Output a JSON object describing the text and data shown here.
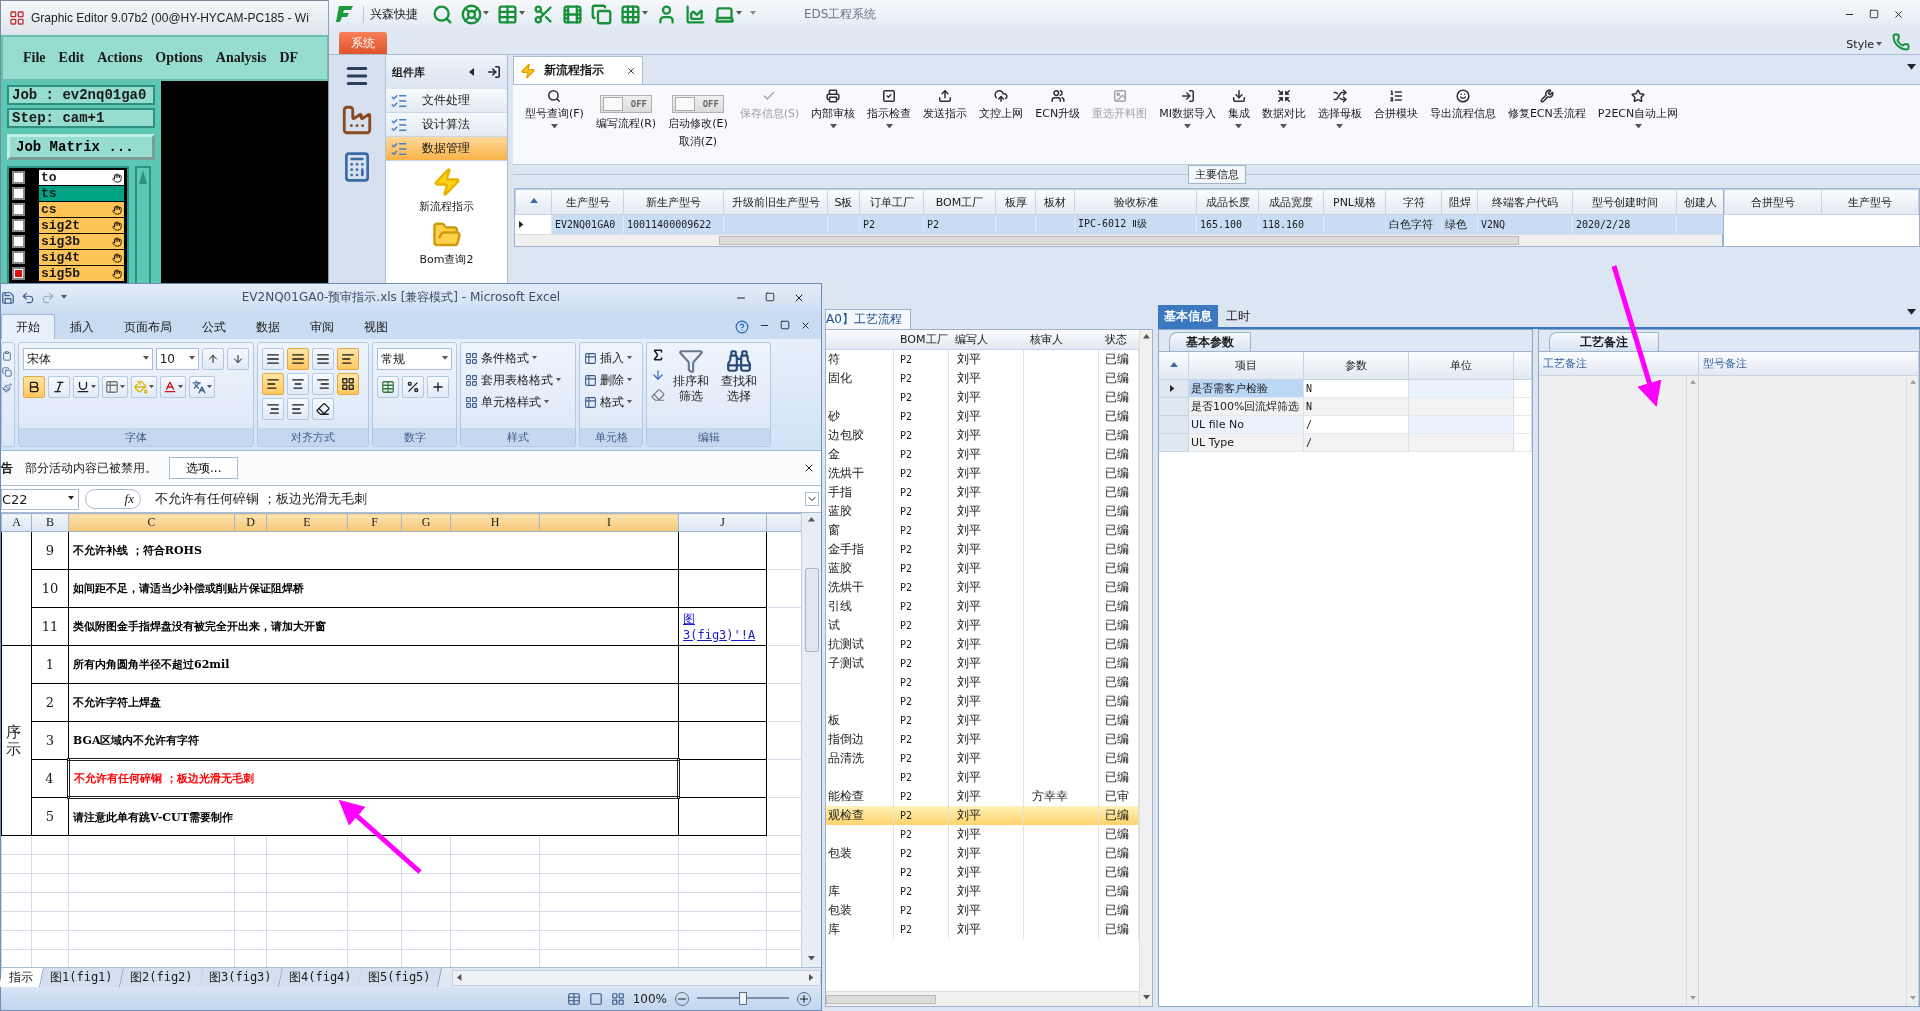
{
  "graphic_editor": {
    "title": "Graphic Editor 9.07b2 (00@HY-HYCAM-PC185 - Wi",
    "menu": [
      "File",
      "Edit",
      "Actions",
      "Options",
      "Analysis",
      "DF"
    ],
    "job": "Job : ev2nq01ga0",
    "step": "Step: cam+1",
    "matrix_button": "Job Matrix ...",
    "layers": [
      {
        "name": "to",
        "color": "#ffffff",
        "checked": false,
        "pointer": true
      },
      {
        "name": "ts",
        "color": "#00a383",
        "checked": false,
        "pointer": false
      },
      {
        "name": "cs",
        "color": "#ffc457",
        "checked": false,
        "pointer": true
      },
      {
        "name": "sig2t",
        "color": "#ffc457",
        "checked": false,
        "pointer": true
      },
      {
        "name": "sig3b",
        "color": "#ffc457",
        "checked": false,
        "pointer": true
      },
      {
        "name": "sig4t",
        "color": "#ffc457",
        "checked": false,
        "pointer": true
      },
      {
        "name": "sig5b",
        "color": "#ffc457",
        "checked": true,
        "pointer": true
      }
    ]
  },
  "eds": {
    "quick_label": "兴森快捷",
    "title": "EDS工程系统",
    "system_tab": "系统",
    "style_menu": "Style",
    "components": {
      "title": "组件库",
      "items": [
        {
          "label": "文件处理",
          "selected": false
        },
        {
          "label": "设计算法",
          "selected": false
        },
        {
          "label": "数据管理",
          "selected": true
        }
      ],
      "launchers": [
        "新流程指示",
        "Bom查询2"
      ]
    },
    "doc_tab": "新流程指示",
    "toolbar": [
      {
        "kind": "button",
        "label": "型号查询(F)",
        "dropdown": true,
        "disabled": false
      },
      {
        "kind": "toggle",
        "label": "编写流程(R)",
        "state_text": "OFF",
        "on": false
      },
      {
        "kind": "toggle",
        "label": "启动修改(E)",
        "sublabel": "取消(Z)",
        "state_text": "OFF",
        "on": false
      },
      {
        "kind": "button",
        "label": "保存信息(S)",
        "dropdown": false,
        "disabled": true
      },
      {
        "kind": "button",
        "label": "内部审核",
        "dropdown": true,
        "disabled": false
      },
      {
        "kind": "button",
        "label": "指示检查",
        "dropdown": true,
        "disabled": false
      },
      {
        "kind": "button",
        "label": "发送指示",
        "dropdown": false,
        "disabled": false
      },
      {
        "kind": "button",
        "label": "文控上网",
        "dropdown": false,
        "disabled": false
      },
      {
        "kind": "button",
        "label": "ECN升级",
        "dropdown": false,
        "disabled": false
      },
      {
        "kind": "button",
        "label": "重选开料图",
        "dropdown": false,
        "disabled": true
      },
      {
        "kind": "button",
        "label": "MI数据导入",
        "dropdown": true,
        "disabled": false
      },
      {
        "kind": "button",
        "label": "集成",
        "dropdown": true,
        "disabled": false
      },
      {
        "kind": "button",
        "label": "数据对比",
        "dropdown": true,
        "disabled": false
      },
      {
        "kind": "button",
        "label": "选择母板",
        "dropdown": true,
        "disabled": false
      },
      {
        "kind": "button",
        "label": "合拼模块",
        "dropdown": false,
        "disabled": false
      },
      {
        "kind": "button",
        "label": "导出流程信息",
        "dropdown": false,
        "disabled": false
      },
      {
        "kind": "button",
        "label": "修复ECN丢流程",
        "dropdown": false,
        "disabled": false
      },
      {
        "kind": "button",
        "label": "P2ECN自动上网",
        "dropdown": true,
        "disabled": false
      }
    ],
    "main_info": {
      "legend": "主要信息",
      "row_selected": true,
      "columns": [
        {
          "label": "生产型号",
          "value": "EV2NQ01GA0"
        },
        {
          "label": "新生产型号",
          "value": "10011400009622"
        },
        {
          "label": "升级前旧生产型号"
        },
        {
          "label": "S板"
        },
        {
          "label": "订单工厂",
          "value": "P2"
        },
        {
          "label": "BOM工厂",
          "value": "P2"
        },
        {
          "label": "板厚"
        },
        {
          "label": "板材"
        },
        {
          "label": "验收标准",
          "value": "IPC-6012 Ⅱ级"
        },
        {
          "label": "成品长度",
          "value": "165.100"
        },
        {
          "label": "成品宽度",
          "value": "118.160"
        },
        {
          "label": "PNL规格"
        },
        {
          "label": "字符",
          "value": "白色字符"
        },
        {
          "label": "阻焊",
          "value": "绿色"
        },
        {
          "label": "终端客户代码",
          "value": "V2NQ"
        },
        {
          "label": "型号创建时间",
          "value": "2020/2/28"
        },
        {
          "label": "创建人"
        }
      ],
      "side_columns": [
        "合拼型号",
        "生产型号"
      ]
    },
    "process": {
      "tab": "A0】工艺流程",
      "columns": [
        "BOM工厂",
        "编写人",
        "核审人",
        "状态"
      ],
      "rows": [
        {
          "step": "符",
          "factory": "P2",
          "author": "刘平",
          "status": "已编",
          "selected": false
        },
        {
          "step": "固化",
          "factory": "P2",
          "author": "刘平",
          "status": "已编",
          "selected": false
        },
        {
          "factory": "P2",
          "author": "刘平",
          "status": "已编",
          "selected": false
        },
        {
          "step": "砂",
          "factory": "P2",
          "author": "刘平",
          "status": "已编",
          "selected": false
        },
        {
          "step": "边包胶",
          "factory": "P2",
          "author": "刘平",
          "status": "已编",
          "selected": false
        },
        {
          "step": "金",
          "factory": "P2",
          "author": "刘平",
          "status": "已编",
          "selected": false
        },
        {
          "step": "洗烘干",
          "factory": "P2",
          "author": "刘平",
          "status": "已编",
          "selected": false
        },
        {
          "step": "手指",
          "factory": "P2",
          "author": "刘平",
          "status": "已编",
          "selected": false
        },
        {
          "step": "蓝胶",
          "factory": "P2",
          "author": "刘平",
          "status": "已编",
          "selected": false
        },
        {
          "step": "窗",
          "factory": "P2",
          "author": "刘平",
          "status": "已编",
          "selected": false
        },
        {
          "step": "金手指",
          "factory": "P2",
          "author": "刘平",
          "status": "已编",
          "selected": false
        },
        {
          "step": "蓝胶",
          "factory": "P2",
          "author": "刘平",
          "status": "已编",
          "selected": false
        },
        {
          "step": "洗烘干",
          "factory": "P2",
          "author": "刘平",
          "status": "已编",
          "selected": false
        },
        {
          "step": "引线",
          "factory": "P2",
          "author": "刘平",
          "status": "已编",
          "selected": false
        },
        {
          "step": "试",
          "factory": "P2",
          "author": "刘平",
          "status": "已编",
          "selected": false
        },
        {
          "step": "抗测试",
          "factory": "P2",
          "author": "刘平",
          "status": "已编",
          "selected": false
        },
        {
          "step": "子测试",
          "factory": "P2",
          "author": "刘平",
          "status": "已编",
          "selected": false
        },
        {
          "factory": "P2",
          "author": "刘平",
          "status": "已编",
          "selected": false
        },
        {
          "factory": "P2",
          "author": "刘平",
          "status": "已编",
          "selected": false
        },
        {
          "step": "板",
          "factory": "P2",
          "author": "刘平",
          "status": "已编",
          "selected": false
        },
        {
          "step": "指倒边",
          "factory": "P2",
          "author": "刘平",
          "status": "已编",
          "selected": false
        },
        {
          "step": "品清洗",
          "factory": "P2",
          "author": "刘平",
          "status": "已编",
          "selected": false
        },
        {
          "factory": "P2",
          "author": "刘平",
          "status": "已编",
          "selected": false
        },
        {
          "step": "能检查",
          "factory": "P2",
          "author": "刘平",
          "reviewer": "方幸幸",
          "status": "已审",
          "selected": false
        },
        {
          "step": "观检查",
          "factory": "P2",
          "author": "刘平",
          "status": "已编",
          "selected": true
        },
        {
          "factory": "P2",
          "author": "刘平",
          "status": "已编",
          "selected": false
        },
        {
          "step": "包装",
          "factory": "P2",
          "author": "刘平",
          "status": "已编",
          "selected": false
        },
        {
          "factory": "P2",
          "author": "刘平",
          "status": "已编",
          "selected": false
        },
        {
          "step": "库",
          "factory": "P2",
          "author": "刘平",
          "status": "已编",
          "selected": false
        },
        {
          "step": "包装",
          "factory": "P2",
          "author": "刘平",
          "status": "已编",
          "selected": false
        },
        {
          "step": "库",
          "factory": "P2",
          "author": "刘平",
          "status": "已编",
          "selected": false
        }
      ]
    },
    "detail_tabs": [
      {
        "label": "基本信息",
        "selected": true
      },
      {
        "label": "工时",
        "selected": false
      }
    ],
    "basic": {
      "section": "基本参数",
      "columns": [
        "项目",
        "参数",
        "单位"
      ],
      "rows": [
        {
          "item": "是否需客户检验",
          "value": "N",
          "selected": true
        },
        {
          "item": "是否100%回流焊筛选",
          "value": "N",
          "selected": false
        },
        {
          "item": "UL file No",
          "value": "/",
          "selected": false
        },
        {
          "item": "UL Type",
          "value": "/",
          "selected": false
        }
      ]
    },
    "remarks": {
      "section": "工艺备注",
      "columns": [
        "工艺备注",
        "型号备注"
      ]
    }
  },
  "excel": {
    "title": "EV2NQ01GA0-预审指示.xls  [兼容模式] - Microsoft Excel",
    "ribbon_tabs": [
      {
        "label": "开始",
        "selected": true
      },
      {
        "label": "插入",
        "selected": false
      },
      {
        "label": "页面布局",
        "selected": false
      },
      {
        "label": "公式",
        "selected": false
      },
      {
        "label": "数据",
        "selected": false
      },
      {
        "label": "审阅",
        "selected": false
      },
      {
        "label": "视图",
        "selected": false
      }
    ],
    "font": "宋体",
    "font_size": "10",
    "number_format": "常规",
    "style_buttons": [
      "条件格式",
      "套用表格格式",
      "单元格样式"
    ],
    "cell_buttons": [
      "插入",
      "删除",
      "格式"
    ],
    "edit_buttons": [
      "排序和筛选",
      "查找和选择"
    ],
    "groups": [
      "字体",
      "对齐方式",
      "数字",
      "样式",
      "单元格",
      "编辑"
    ],
    "message": {
      "title": "告",
      "text": "部分活动内容已被禁用。",
      "button": "选项..."
    },
    "name_box": "C22",
    "function_label": "fx",
    "formula": "不允许有任何碎铜 ；板边光滑无毛刺",
    "columns": [
      "A",
      "B",
      "C",
      "D",
      "E",
      "F",
      "G",
      "H",
      "I",
      "J"
    ],
    "sections": [
      {
        "rows": [
          {
            "num": "9",
            "text": "不允许补线 ；符合ROHS",
            "color": "#000000",
            "selected": false
          },
          {
            "num": "10",
            "text": "如间距不足，请适当少补偿或削贴片保证阻焊桥",
            "color": "#000000",
            "selected": false
          },
          {
            "num": "11",
            "text": "类似附图金手指焊盘没有被完全开出来，请加大开窗",
            "color": "#000000",
            "selected": false,
            "link": "图3(fig3)'!A"
          }
        ]
      },
      {
        "label": "序示",
        "rows": [
          {
            "num": "1",
            "text": "所有内角圆角半径不超过62mil",
            "color": "#000000",
            "selected": false
          },
          {
            "num": "2",
            "text": "不允许字符上焊盘",
            "color": "#000000",
            "selected": false
          },
          {
            "num": "3",
            "text": "BGA区域内不允许有字符",
            "color": "#000000",
            "selected": false
          },
          {
            "num": "4",
            "text": "不允许有任何碎铜 ；板边光滑无毛刺",
            "color": "#ff0000",
            "selected": true
          },
          {
            "num": "5",
            "text": "请注意此单有跳V-CUT需要制作",
            "color": "#000000",
            "selected": false
          }
        ]
      }
    ],
    "sheet_tabs": [
      {
        "label": "指示",
        "selected": true
      },
      {
        "label": "图1(fig1)",
        "selected": false
      },
      {
        "label": "图2(fig2)",
        "selected": false
      },
      {
        "label": "图3(fig3)",
        "selected": false
      },
      {
        "label": "图4(fig4)",
        "selected": false
      },
      {
        "label": "图5(fig5)",
        "selected": false
      }
    ],
    "zoom": {
      "label": "100%",
      "level": 0.5
    }
  }
}
